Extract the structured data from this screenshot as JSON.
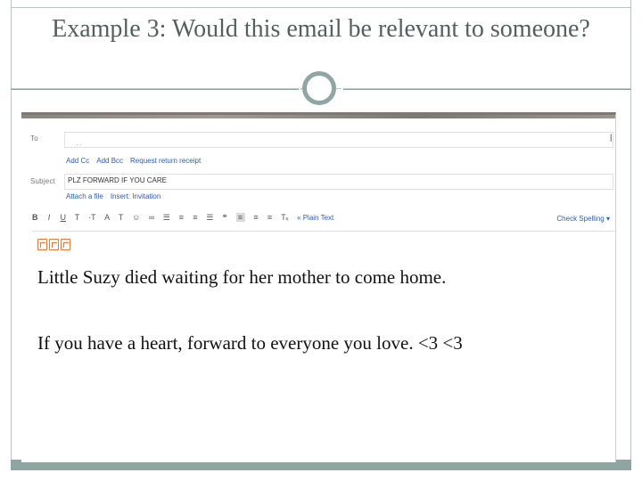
{
  "slide": {
    "title": "Example 3: Would this email be relevant to someone?"
  },
  "email": {
    "to_label": "To",
    "to_value": ", .",
    "recipient_links": [
      "Add Cc",
      "Add Bcc",
      "Request return receipt"
    ],
    "subject_label": "Subject",
    "subject_value": "PLZ FORWARD IF YOU CARE",
    "attach_links": [
      "Attach a file",
      "Insert: Invitation"
    ],
    "toolbar": [
      "B",
      "I",
      "U",
      "T",
      "·T",
      "A",
      "T",
      "☺",
      "∞",
      "☰",
      "≡",
      "≡",
      "☰",
      "❝",
      "≡",
      "≡",
      "≡",
      "Tₓ"
    ],
    "plain_text_link": "« Plain Text",
    "check_spelling": "Check Spelling ▾",
    "body_lines": [
      "Little Suzy died waiting for her mother to come home.",
      "If you have a heart, forward to everyone you love. <3 <3"
    ]
  },
  "colors": {
    "title_text": "#555f5d",
    "frame": "#8ea5a1",
    "link": "#2a5db0",
    "emoji": "#e07b3c"
  }
}
